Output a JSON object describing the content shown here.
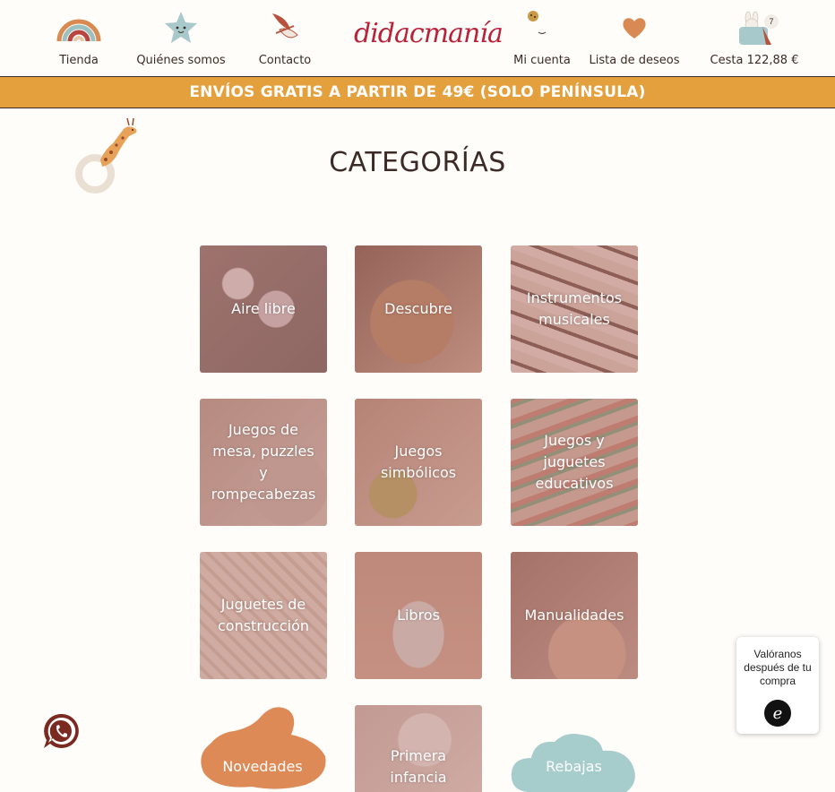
{
  "header": {
    "nav": [
      {
        "label": "Tienda",
        "icon": "rainbow-icon"
      },
      {
        "label": "Quiénes somos",
        "icon": "star-icon"
      },
      {
        "label": "Contacto",
        "icon": "bird-icon"
      }
    ],
    "logo": "didacmanía",
    "account": [
      {
        "label": "Mi cuenta",
        "icon": "moon-icon"
      },
      {
        "label": "Lista de deseos",
        "icon": "heart-icon"
      },
      {
        "label": "Cesta 122,88 €",
        "icon": "basket-icon",
        "badge": "7"
      }
    ]
  },
  "banner": {
    "text": "ENVÍOS GRATIS A PARTIR DE 49€ (SOLO PENÍNSULA)"
  },
  "page": {
    "title": "CATEGORÍAS"
  },
  "categories": [
    {
      "label": "Aire libre"
    },
    {
      "label": "Descubre"
    },
    {
      "label": "Instrumentos musicales"
    },
    {
      "label": "Juegos de mesa, puzzles y rompecabezas"
    },
    {
      "label": "Juegos simbólicos"
    },
    {
      "label": "Juegos y juguetes educativos"
    },
    {
      "label": "Juguetes de construcción"
    },
    {
      "label": "Libros"
    },
    {
      "label": "Manualidades"
    },
    {
      "label": "Novedades"
    },
    {
      "label": "Primera infancia"
    },
    {
      "label": "Rebajas"
    }
  ],
  "review_widget": {
    "text": "Valóranos después de tu compra"
  },
  "colors": {
    "banner": "#e4a03c",
    "logo": "#b8233a",
    "text": "#3b2a26",
    "novedades": "#dd8a56",
    "rebajas": "#a6cccb"
  }
}
